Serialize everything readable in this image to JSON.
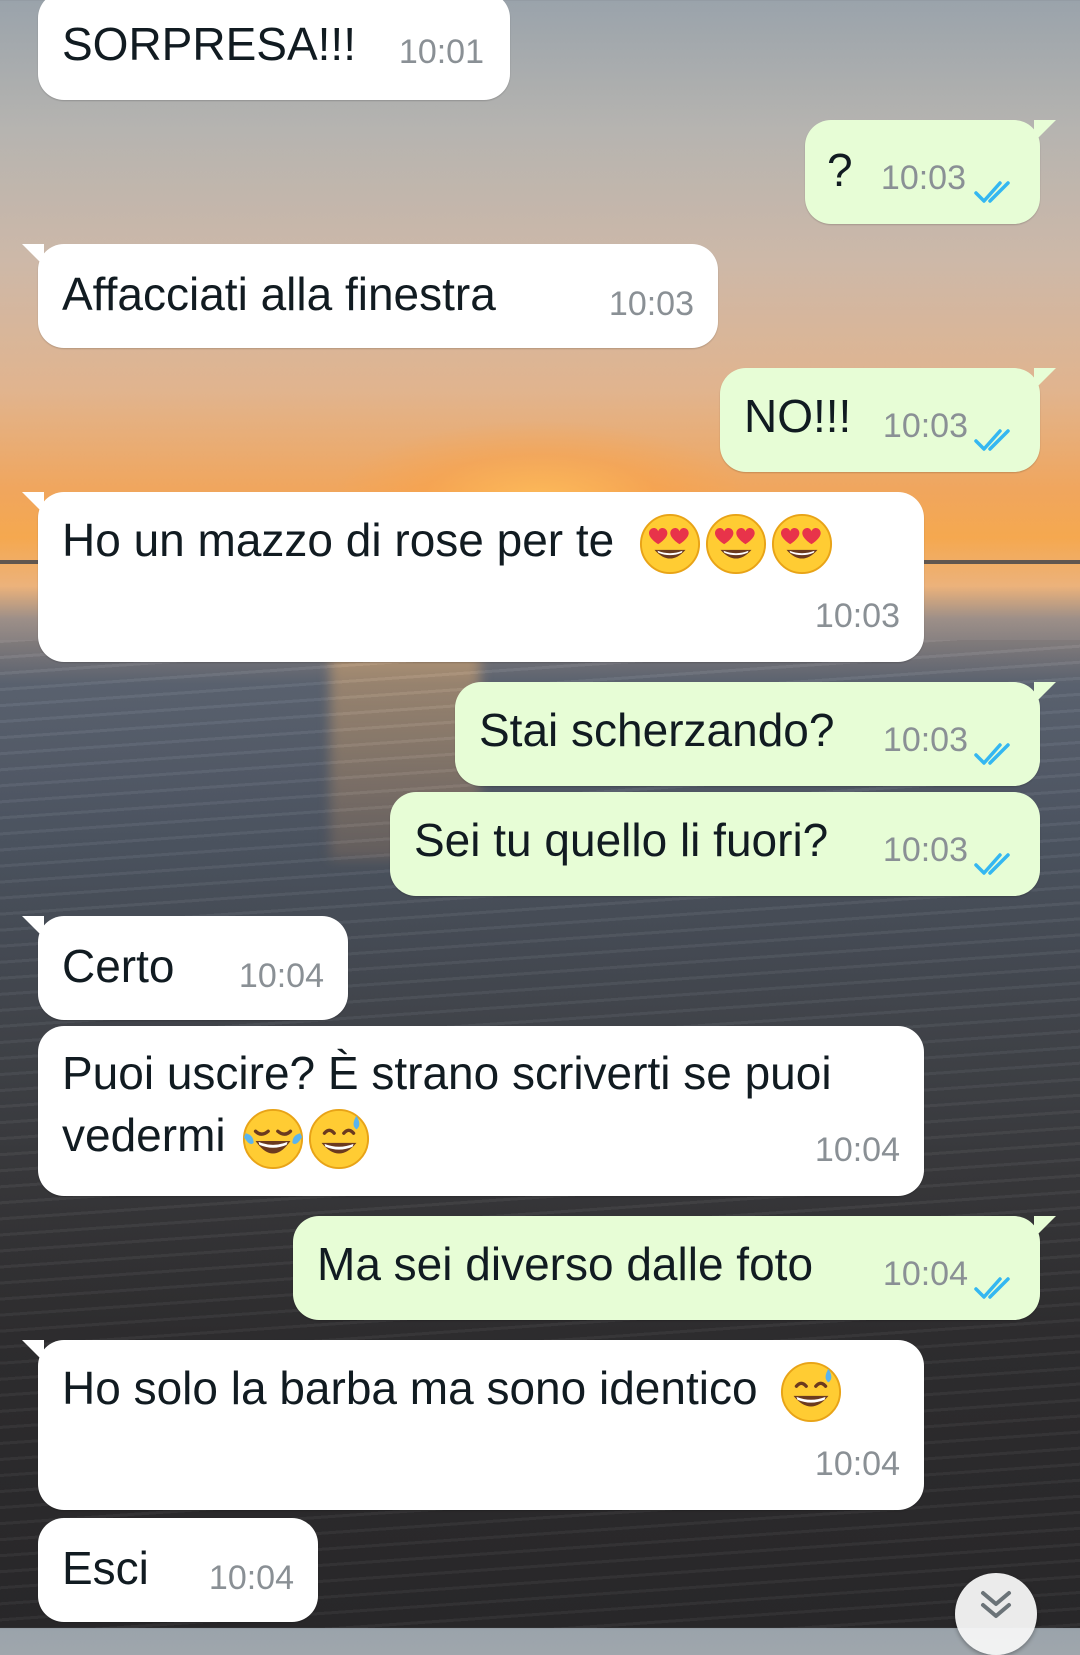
{
  "messages": [
    {
      "text": "SORPRESA!!!",
      "time": "10:01"
    },
    {
      "text": "?",
      "time": "10:03"
    },
    {
      "text": "Affacciati alla finestra",
      "time": "10:03"
    },
    {
      "text": "NO!!!",
      "time": "10:03"
    },
    {
      "text": "Ho un mazzo di rose per te",
      "time": "10:03",
      "emojis": [
        "heart-eyes",
        "heart-eyes",
        "heart-eyes"
      ]
    },
    {
      "text": "Stai scherzando?",
      "time": "10:03"
    },
    {
      "text": "Sei tu quello li fuori?",
      "time": "10:03"
    },
    {
      "text": "Certo",
      "time": "10:04"
    },
    {
      "text": "Puoi uscire? È strano scriverti se puoi vedermi",
      "time": "10:04",
      "emojis": [
        "tears-of-joy",
        "sweat-smile"
      ]
    },
    {
      "text": "Ma sei diverso dalle foto",
      "time": "10:04"
    },
    {
      "text": "Ho solo la barba ma sono identico",
      "time": "10:04",
      "emojis": [
        "sweat-smile"
      ]
    },
    {
      "text": "Esci",
      "time": "10:04"
    }
  ],
  "colors": {
    "incoming_bubble": "#ffffff",
    "outgoing_bubble": "#e7fdd6",
    "timestamp": "#8a9095",
    "read_ticks": "#34b7f1"
  },
  "icons": {
    "read_receipt": "double-check-icon",
    "scroll_down": "chevron-double-down-icon"
  }
}
